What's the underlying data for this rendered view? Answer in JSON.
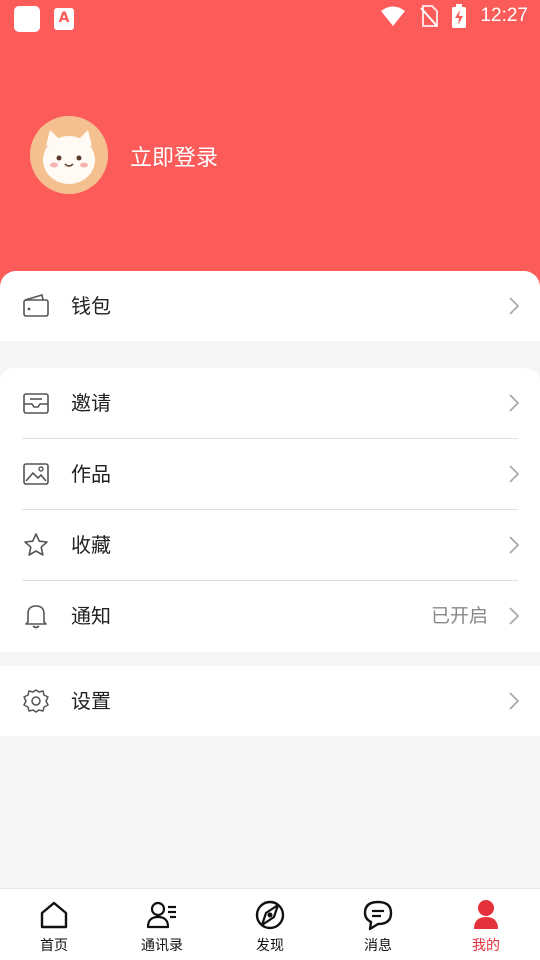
{
  "status_bar": {
    "time": "12:27",
    "app_badge": "A"
  },
  "header": {
    "login_label": "立即登录"
  },
  "menu": {
    "wallet": {
      "label": "钱包"
    },
    "invite": {
      "label": "邀请"
    },
    "works": {
      "label": "作品"
    },
    "favorites": {
      "label": "收藏"
    },
    "notifications": {
      "label": "通知",
      "value": "已开启"
    },
    "settings": {
      "label": "设置"
    }
  },
  "bottom_nav": {
    "items": [
      {
        "label": "首页",
        "icon": "home-icon"
      },
      {
        "label": "通讯录",
        "icon": "contacts-icon"
      },
      {
        "label": "发现",
        "icon": "discover-icon"
      },
      {
        "label": "消息",
        "icon": "message-icon"
      },
      {
        "label": "我的",
        "icon": "profile-icon"
      }
    ],
    "active_index": 4
  },
  "colors": {
    "brand": "#fb5c5a",
    "active": "#e5323a"
  }
}
